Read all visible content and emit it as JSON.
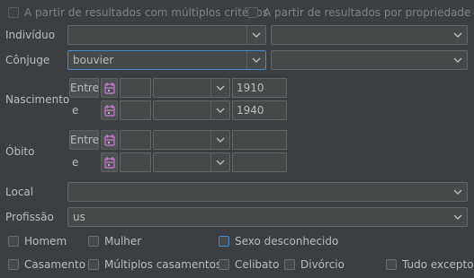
{
  "top_options": {
    "multi_criteria": "A partir de resultados com múltiplos critérios",
    "by_property": "A partir de resultados por propriedade"
  },
  "individual": {
    "label": "Indivíduo",
    "value": "",
    "value2": ""
  },
  "spouse": {
    "label": "Cônjuge",
    "value": "bouvier",
    "value2": ""
  },
  "birth": {
    "label": "Nascimento",
    "between_label": "Entre",
    "and_label": "e",
    "from_modifier": "",
    "from_qualifier": "",
    "from_year": "1910",
    "to_modifier": "",
    "to_qualifier": "",
    "to_year": "1940"
  },
  "death": {
    "label": "Óbito",
    "between_label": "Entre",
    "and_label": "e",
    "from_modifier": "",
    "from_qualifier": "",
    "from_year": "",
    "to_modifier": "",
    "to_qualifier": "",
    "to_year": ""
  },
  "place": {
    "label": "Local",
    "value": ""
  },
  "profession": {
    "label": "Profissão",
    "value": "us"
  },
  "sex": {
    "male": "Homem",
    "female": "Mulher",
    "unknown": "Sexo desconhecido"
  },
  "marriage": {
    "married": "Casamento",
    "multiple": "Múltiplos casamentos",
    "celibate": "Celibato",
    "divorce": "Divórcio",
    "all_except": "Tudo excepto"
  },
  "icons": {
    "dropdown": "chevron-down-icon",
    "date_picker": "calendar-icon"
  },
  "colors": {
    "background": "#3c3f41",
    "field": "#45494a",
    "border": "#646464",
    "focus": "#4a88c7",
    "text": "#bbbbbb",
    "date_icon": "#c87fd0"
  }
}
